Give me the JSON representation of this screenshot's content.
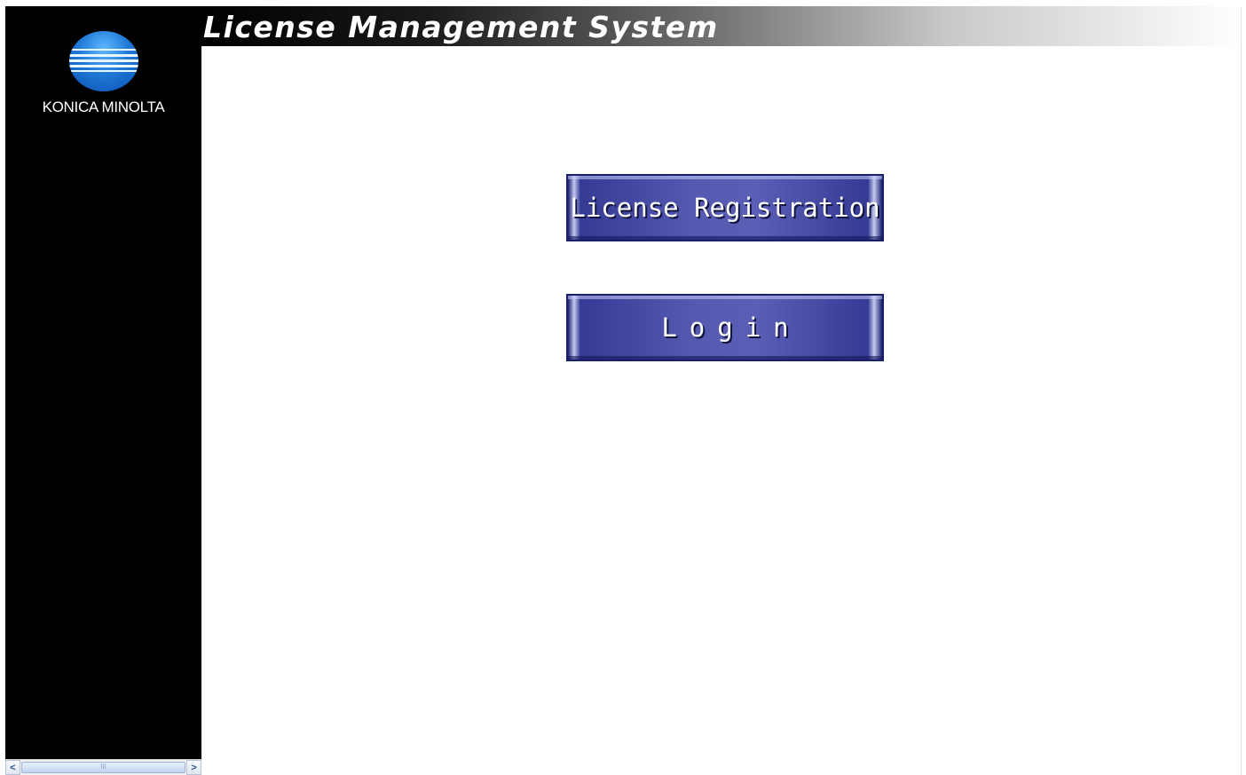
{
  "header": {
    "title": "License Management System"
  },
  "sidebar": {
    "logo_text": "KONICA MINOLTA",
    "logo_icon": "konica-minolta-globe-icon"
  },
  "main": {
    "buttons": [
      {
        "label": "License Registration"
      },
      {
        "label": "Login"
      }
    ]
  },
  "scrollbar": {
    "left_arrow": "<",
    "right_arrow": ">",
    "thumb_grip": "III"
  },
  "colors": {
    "button_fill": "#5559b0",
    "sidebar_bg": "#000000",
    "logo_blue": "#1f7ad6"
  }
}
